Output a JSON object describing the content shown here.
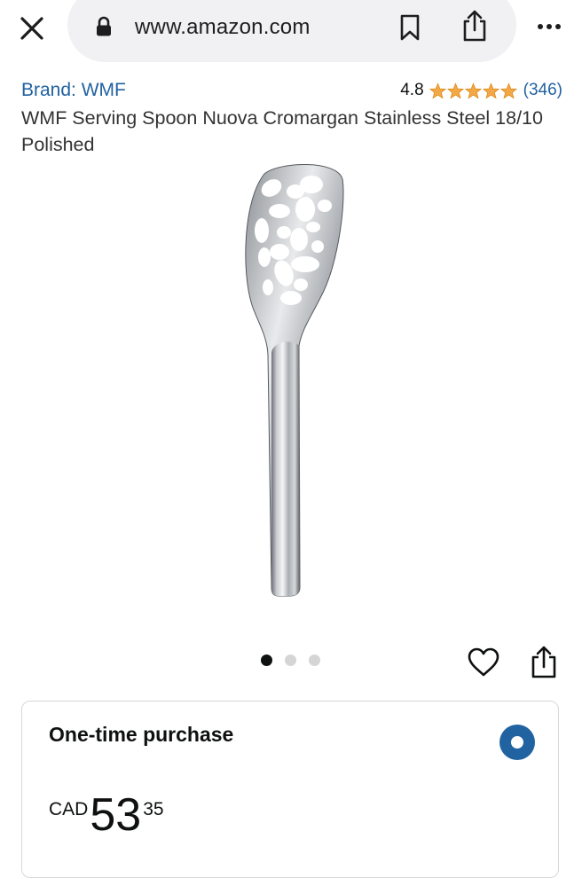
{
  "browser": {
    "url": "www.amazon.com",
    "icons": {
      "close": "close-icon",
      "lock": "lock-icon",
      "bookmark": "bookmark-icon",
      "share": "share-icon",
      "more": "more-dots-icon"
    }
  },
  "product": {
    "brand_link": "Brand: WMF",
    "rating": "4.8",
    "stars": 4.8,
    "review_count": "(346)",
    "title": "WMF Serving Spoon Nuova Cromargan Stainless Steel 18/10 Polished"
  },
  "carousel": {
    "image_count": 3,
    "active_index": 0
  },
  "actions": {
    "wishlist_icon": "heart-icon",
    "share_icon": "share-icon"
  },
  "purchase": {
    "label": "One-time purchase",
    "selected": true,
    "currency": "CAD",
    "price_whole": "53",
    "price_fraction": "35"
  },
  "colors": {
    "link": "#2162a1",
    "star": "#f3a847",
    "radio": "#2162a1"
  }
}
